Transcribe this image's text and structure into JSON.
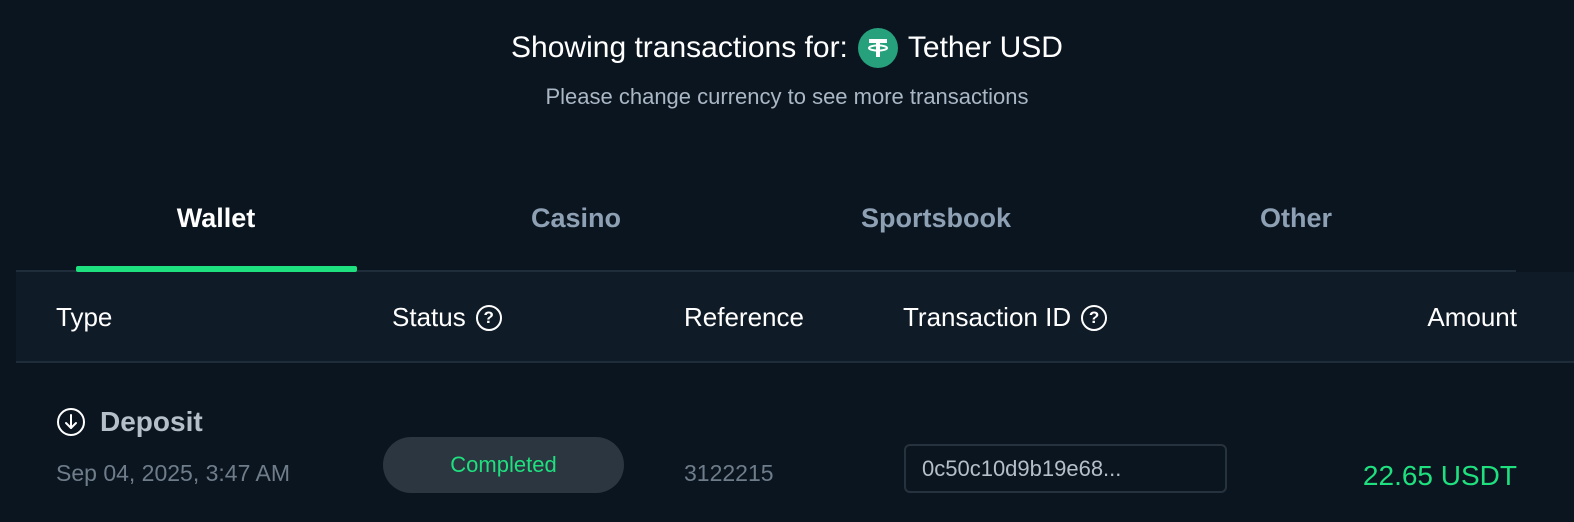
{
  "header": {
    "title_prefix": "Showing transactions for:",
    "currency_name": "Tether USD",
    "currency_icon": "tether-icon",
    "subtitle": "Please change currency to see more transactions"
  },
  "tabs": [
    {
      "label": "Wallet",
      "active": true
    },
    {
      "label": "Casino",
      "active": false
    },
    {
      "label": "Sportsbook",
      "active": false
    },
    {
      "label": "Other",
      "active": false
    }
  ],
  "table": {
    "columns": [
      "Type",
      "Status",
      "Reference",
      "Transaction ID",
      "Amount"
    ],
    "rows": [
      {
        "type": "Deposit",
        "type_icon": "arrow-down-circle-icon",
        "date": "Sep 04, 2025, 3:47 AM",
        "status": "Completed",
        "reference": "3122215",
        "transaction_id": "0c50c10d9b19e68...",
        "amount": "22.65 USDT"
      }
    ]
  },
  "colors": {
    "background": "#0b1520",
    "accent_green": "#1fe07e",
    "tether_green": "#26a17b"
  }
}
